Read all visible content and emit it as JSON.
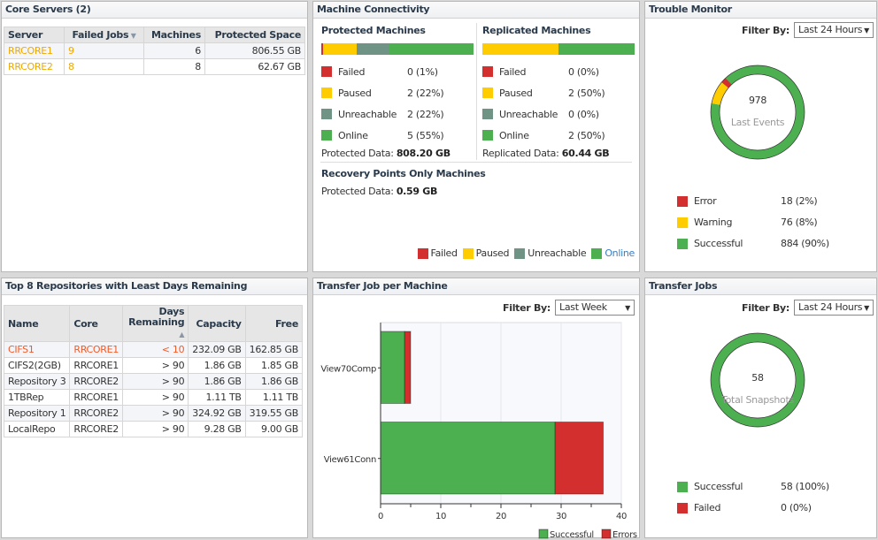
{
  "colors": {
    "failed": "#d32f2f",
    "paused": "#ffcc00",
    "unreachable": "#6f9485",
    "online": "#4caf50"
  },
  "core_servers": {
    "title": "Core Servers (2)",
    "headers": [
      "Server",
      "Failed Jobs",
      "Machines",
      "Protected Space"
    ],
    "rows": [
      [
        "RRCORE1",
        "9",
        "6",
        "806.55 GB"
      ],
      [
        "RRCORE2",
        "8",
        "8",
        "62.67 GB"
      ]
    ]
  },
  "connectivity": {
    "title": "Machine Connectivity",
    "protected": {
      "title": "Protected Machines",
      "percents": [
        1,
        22,
        22,
        55
      ],
      "items": [
        {
          "label": "Failed",
          "value": "0 (1%)"
        },
        {
          "label": "Paused",
          "value": "2 (22%)"
        },
        {
          "label": "Unreachable",
          "value": "2 (22%)"
        },
        {
          "label": "Online",
          "value": "5 (55%)"
        }
      ],
      "data_label": "Protected Data:",
      "data_value": "808.20 GB"
    },
    "replicated": {
      "title": "Replicated Machines",
      "percents": [
        0,
        50,
        0,
        50
      ],
      "items": [
        {
          "label": "Failed",
          "value": "0 (0%)"
        },
        {
          "label": "Paused",
          "value": "2 (50%)"
        },
        {
          "label": "Unreachable",
          "value": "0 (0%)"
        },
        {
          "label": "Online",
          "value": "2 (50%)"
        }
      ],
      "data_label": "Replicated Data:",
      "data_value": "60.44 GB"
    },
    "rp": {
      "title": "Recovery Points Only Machines",
      "data_label": "Protected Data:",
      "data_value": "0.59 GB"
    },
    "legend": [
      "Failed",
      "Paused",
      "Unreachable",
      "Online"
    ]
  },
  "trouble": {
    "title": "Trouble Monitor",
    "filter_label": "Filter By:",
    "filter_value": "Last 24 Hours",
    "center_value": "978",
    "center_label": "Last Events",
    "items": [
      {
        "label": "Error",
        "value": "18 (2%)",
        "pct": 2,
        "color": "#d32f2f"
      },
      {
        "label": "Warning",
        "value": "76 (8%)",
        "pct": 8,
        "color": "#ffcc00"
      },
      {
        "label": "Successful",
        "value": "884 (90%)",
        "pct": 90,
        "color": "#4caf50"
      }
    ]
  },
  "repos": {
    "title": "Top 8 Repositories with Least Days Remaining",
    "headers": [
      "Name",
      "Core",
      "Days Remaining",
      "Capacity",
      "Free"
    ],
    "rows": [
      [
        "CIFS1",
        "RRCORE1",
        "< 10",
        "232.09 GB",
        "162.85 GB"
      ],
      [
        "CIFS2(2GB)",
        "RRCORE1",
        "> 90",
        "1.86 GB",
        "1.85 GB"
      ],
      [
        "Repository 3",
        "RRCORE2",
        "> 90",
        "1.86 GB",
        "1.86 GB"
      ],
      [
        "1TBRep",
        "RRCORE1",
        "> 90",
        "1.11 TB",
        "1.11 TB"
      ],
      [
        "Repository 1",
        "RRCORE2",
        "> 90",
        "324.92 GB",
        "319.55 GB"
      ],
      [
        "LocalRepo",
        "RRCORE2",
        "> 90",
        "9.28 GB",
        "9.00 GB"
      ]
    ]
  },
  "transfer_machine": {
    "title": "Transfer Job per Machine",
    "filter_label": "Filter By:",
    "filter_value": "Last Week"
  },
  "chart_data": {
    "type": "bar",
    "orientation": "horizontal",
    "stacked": true,
    "categories": [
      "View70Comp",
      "View61Conn"
    ],
    "series": [
      {
        "name": "Successful",
        "values": [
          4,
          29
        ],
        "color": "#4caf50"
      },
      {
        "name": "Errors",
        "values": [
          1,
          8
        ],
        "color": "#d32f2f"
      }
    ],
    "xlim": [
      0,
      40
    ],
    "xticks": [
      "0",
      "10",
      "20",
      "30",
      "40"
    ],
    "grid": true,
    "legend": "bottom-right"
  },
  "transfer_jobs": {
    "title": "Transfer Jobs",
    "filter_label": "Filter By:",
    "filter_value": "Last 24 Hours",
    "center_value": "58",
    "center_label": "Total Snapshots",
    "items": [
      {
        "label": "Successful",
        "value": "58 (100%)",
        "pct": 100,
        "color": "#4caf50"
      },
      {
        "label": "Failed",
        "value": "0 (0%)",
        "pct": 0,
        "color": "#d32f2f"
      }
    ]
  }
}
